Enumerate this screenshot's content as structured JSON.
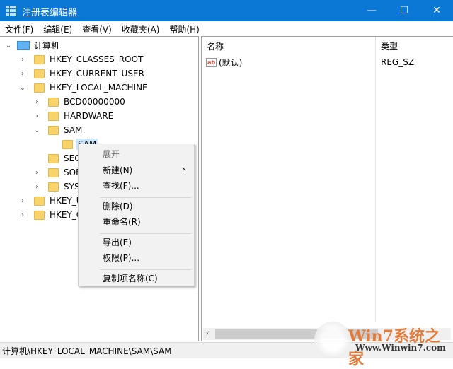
{
  "window": {
    "title": "注册表编辑器",
    "minimize": "—",
    "maximize": "☐",
    "close": "✕"
  },
  "menu": [
    "文件(F)",
    "编辑(E)",
    "查看(V)",
    "收藏夹(A)",
    "帮助(H)"
  ],
  "tree": [
    {
      "label": "计算机",
      "level": 0,
      "state": "expanded"
    },
    {
      "label": "HKEY_CLASSES_ROOT",
      "level": 1,
      "state": "collapsed"
    },
    {
      "label": "HKEY_CURRENT_USER",
      "level": 1,
      "state": "collapsed"
    },
    {
      "label": "HKEY_LOCAL_MACHINE",
      "level": 1,
      "state": "expanded"
    },
    {
      "label": "BCD00000000",
      "level": 2,
      "state": "collapsed"
    },
    {
      "label": "HARDWARE",
      "level": 2,
      "state": "collapsed"
    },
    {
      "label": "SAM",
      "level": 2,
      "state": "expanded"
    },
    {
      "label": "SAM",
      "level": 3,
      "state": "leaf",
      "selected": true
    },
    {
      "label": "SECURITY",
      "level": 2,
      "state": "leaf"
    },
    {
      "label": "SOFTWARE",
      "level": 2,
      "state": "collapsed"
    },
    {
      "label": "SYSTEM",
      "level": 2,
      "state": "collapsed"
    },
    {
      "label": "HKEY_USERS",
      "level": 1,
      "state": "collapsed"
    },
    {
      "label": "HKEY_CURRENT_CONFIG",
      "level": 1,
      "state": "collapsed"
    }
  ],
  "list": {
    "columns": {
      "name": "名称",
      "type": "类型"
    },
    "rows": [
      {
        "name": "(默认)",
        "type": "REG_SZ",
        "icon": "ab"
      }
    ]
  },
  "context_menu": [
    {
      "label": "展开",
      "disabled": true
    },
    {
      "label": "新建(N)",
      "submenu": true
    },
    {
      "label": "查找(F)..."
    },
    {
      "sep": true
    },
    {
      "label": "删除(D)"
    },
    {
      "label": "重命名(R)"
    },
    {
      "sep": true
    },
    {
      "label": "导出(E)"
    },
    {
      "label": "权限(P)..."
    },
    {
      "sep": true
    },
    {
      "label": "复制项名称(C)"
    }
  ],
  "status": "计算机\\HKEY_LOCAL_MACHINE\\SAM\\SAM",
  "watermark": {
    "brand": "Win7系统之家",
    "url": "Www.Winwin7.com"
  }
}
